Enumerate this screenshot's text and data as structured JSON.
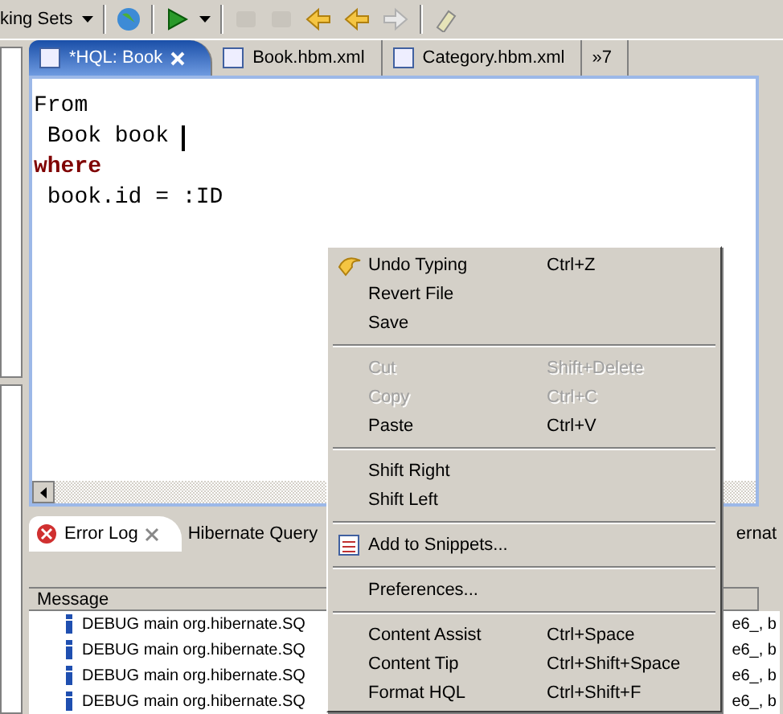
{
  "toolbar": {
    "working_sets": "king Sets"
  },
  "editor_tabs": [
    {
      "label": "*HQL: Book",
      "selected": true,
      "closable": true
    },
    {
      "label": "Book.hbm.xml",
      "selected": false,
      "closable": false
    },
    {
      "label": "Category.hbm.xml",
      "selected": false,
      "closable": false
    }
  ],
  "editor_overflow": {
    "glyph": "»",
    "count": "7"
  },
  "editor_lines": [
    {
      "text": "From",
      "keyword": false
    },
    {
      "text": " Book book ",
      "keyword": false
    },
    {
      "text": "where",
      "keyword": true
    },
    {
      "text": " book.id = :ID",
      "keyword": false
    }
  ],
  "bottom_tabs": [
    {
      "label": "Error Log",
      "selected": true
    },
    {
      "label": "Hibernate Query",
      "selected": false
    }
  ],
  "bottom_tab_cut": "ernat",
  "log_table": {
    "columns": [
      "Message"
    ],
    "rows": [
      {
        "message": "DEBUG main org.hibernate.SQ",
        "tail": "e6_, b"
      },
      {
        "message": "DEBUG main org.hibernate.SQ",
        "tail": "e6_, b"
      },
      {
        "message": "DEBUG main org.hibernate.SQ",
        "tail": "e6_, b"
      },
      {
        "message": "DEBUG main org.hibernate.SQ",
        "tail": "e6_, b"
      }
    ]
  },
  "context_menu": [
    {
      "kind": "icon_item",
      "label": "Undo Typing",
      "shortcut": "Ctrl+Z",
      "disabled": false
    },
    {
      "kind": "item",
      "label": "Revert File",
      "disabled": false
    },
    {
      "kind": "item",
      "label": "Save",
      "disabled": false
    },
    {
      "kind": "separator"
    },
    {
      "kind": "item",
      "label": "Cut",
      "shortcut": "Shift+Delete",
      "disabled": true
    },
    {
      "kind": "item",
      "label": "Copy",
      "shortcut": "Ctrl+C",
      "disabled": true
    },
    {
      "kind": "item",
      "label": "Paste",
      "shortcut": "Ctrl+V",
      "disabled": false
    },
    {
      "kind": "separator"
    },
    {
      "kind": "item",
      "label": "Shift Right",
      "disabled": false
    },
    {
      "kind": "item",
      "label": "Shift Left",
      "disabled": false
    },
    {
      "kind": "separator"
    },
    {
      "kind": "icon_item",
      "label": "Add to Snippets...",
      "disabled": false
    },
    {
      "kind": "separator"
    },
    {
      "kind": "item",
      "label": "Preferences...",
      "disabled": false
    },
    {
      "kind": "separator"
    },
    {
      "kind": "item",
      "label": "Content Assist",
      "shortcut": "Ctrl+Space",
      "disabled": false
    },
    {
      "kind": "item",
      "label": "Content Tip",
      "shortcut": "Ctrl+Shift+Space",
      "disabled": false
    },
    {
      "kind": "item",
      "label": "Format HQL",
      "shortcut": "Ctrl+Shift+F",
      "disabled": false
    }
  ]
}
